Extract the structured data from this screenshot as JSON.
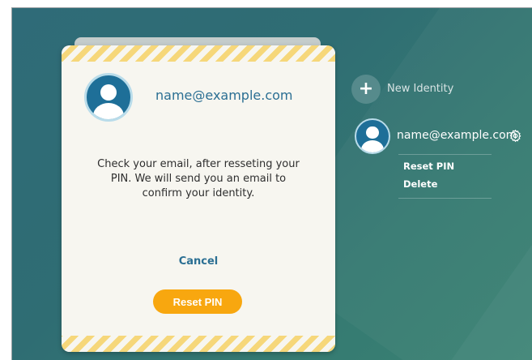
{
  "dialog": {
    "email": "name@example.com",
    "message": "Check your email, after resseting your PIN. We will send you an email to confirm your identity.",
    "cancel_label": "Cancel",
    "reset_label": "Reset PIN",
    "avatar_icon": "user-avatar-icon",
    "accent_color": "#f8a70f",
    "stripe_color": "#f6d77a"
  },
  "sidebar": {
    "new_identity_label": "New Identity",
    "new_identity_icon": "plus-icon",
    "identity": {
      "email": "name@example.com",
      "avatar_icon": "user-avatar-icon",
      "settings_icon": "gear-icon",
      "menu": [
        {
          "label": "Reset PIN"
        },
        {
          "label": "Delete"
        }
      ]
    }
  },
  "theme": {
    "background": "#2f6d73",
    "link_color": "#2b6f93"
  }
}
